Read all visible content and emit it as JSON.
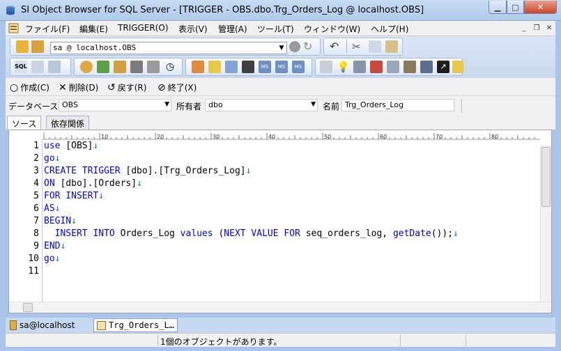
{
  "window": {
    "title": "SI Object Browser for SQL Server - [TRIGGER - OBS.dbo.Trg_Orders_Log @ localhost.OBS]"
  },
  "menu": {
    "items": [
      "ファイル(F)",
      "編集(E)",
      "TRIGGER(O)",
      "表示(V)",
      "管理(A)",
      "ツール(T)",
      "ウィンドウ(W)",
      "ヘルプ(H)"
    ]
  },
  "toolbar": {
    "connection": "sa @ localhost.OBS"
  },
  "actions": {
    "create": "作成(C)",
    "delete": "削除(D)",
    "back": "戻す(R)",
    "exit": "終了(X)"
  },
  "filter": {
    "db_label": "データベース",
    "db_value": "OBS",
    "owner_label": "所有者",
    "owner_value": "dbo",
    "name_label": "名前",
    "name_value": "Trg_Orders_Log"
  },
  "tabs": {
    "source": "ソース",
    "dependencies": "依存関係"
  },
  "editor": {
    "ruler_labels": [
      "10",
      "20",
      "30",
      "40",
      "50",
      "60",
      "70",
      "80"
    ],
    "line_numbers": [
      "1",
      "2",
      "3",
      "4",
      "5",
      "6",
      "7",
      "8",
      "9",
      "10",
      "11"
    ]
  },
  "doc_tabs": {
    "session": "sa@localhost",
    "trigger": "Trg_Orders_L…"
  },
  "status": {
    "message": "1個のオブジェクトがあります。"
  },
  "colors": {
    "keyword": "#0000ff",
    "eol_mark": "#008080",
    "titlebar": "#b9d1ee"
  }
}
